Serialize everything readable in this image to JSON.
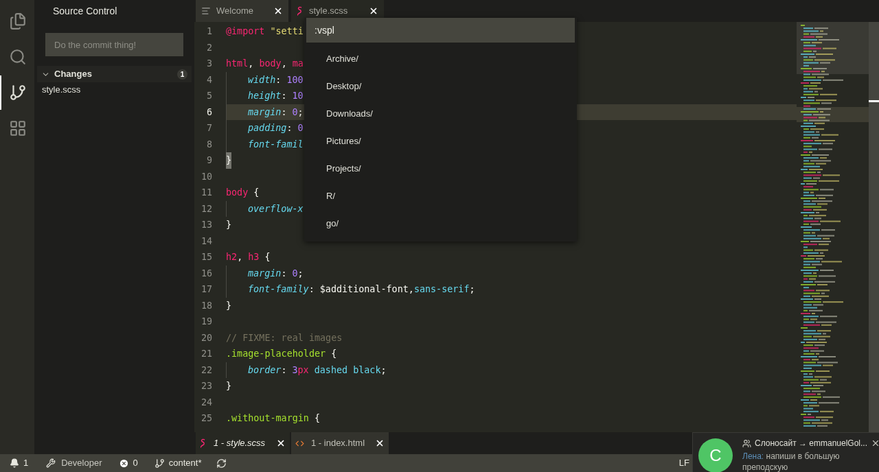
{
  "activity_bar": [
    {
      "kind": "files",
      "selected": false
    },
    {
      "kind": "search",
      "selected": false
    },
    {
      "kind": "source-control",
      "selected": true
    },
    {
      "kind": "extensions",
      "selected": false
    }
  ],
  "sidebar": {
    "title": "Source Control",
    "commit_field": {
      "placeholder": "Do the commit thing!"
    },
    "section": {
      "title": "Changes",
      "count": "1",
      "expanded": true,
      "files": [
        "style.scss"
      ]
    }
  },
  "editor_tabs": [
    {
      "label": "Welcome",
      "kind": "welcome",
      "selected": false
    },
    {
      "label": "style.scss",
      "kind": "scss",
      "selected": true
    }
  ],
  "code_lines": [
    {
      "number": "1",
      "indented": false,
      "current": false,
      "tokens": [
        {
          "kind": "keyword",
          "text": "@import"
        },
        {
          "kind": "string",
          "text": " \"setti"
        }
      ]
    },
    {
      "number": "2",
      "current": false
    },
    {
      "number": "3",
      "indented": false,
      "current": false,
      "tokens": [
        {
          "kind": "keyword",
          "text": "html"
        },
        {
          "kind": "plain",
          "text": ", "
        },
        {
          "kind": "keyword",
          "text": "body"
        },
        {
          "kind": "plain",
          "text": ", "
        },
        {
          "kind": "keyword",
          "text": "ma"
        }
      ]
    },
    {
      "number": "4",
      "indented": true,
      "current": false,
      "tokens": [
        {
          "kind": "property",
          "text": "width"
        },
        {
          "kind": "plain",
          "text": ": "
        },
        {
          "kind": "number",
          "text": "100"
        }
      ]
    },
    {
      "number": "5",
      "indented": true,
      "current": false,
      "tokens": [
        {
          "kind": "property",
          "text": "height"
        },
        {
          "kind": "plain",
          "text": ": "
        },
        {
          "kind": "number",
          "text": "10"
        }
      ]
    },
    {
      "number": "6",
      "indented": true,
      "current": true,
      "tokens": [
        {
          "kind": "property",
          "text": "margin"
        },
        {
          "kind": "plain",
          "text": ": "
        },
        {
          "kind": "number",
          "text": "0"
        },
        {
          "kind": "plain",
          "text": ";"
        }
      ]
    },
    {
      "number": "7",
      "indented": true,
      "current": false,
      "tokens": [
        {
          "kind": "property",
          "text": "padding"
        },
        {
          "kind": "plain",
          "text": ": "
        },
        {
          "kind": "number",
          "text": "0"
        }
      ]
    },
    {
      "number": "8",
      "indented": true,
      "current": false,
      "tokens": [
        {
          "kind": "property",
          "text": "font-famil"
        }
      ]
    },
    {
      "number": "9",
      "indented": false,
      "current": false,
      "tokens": [
        {
          "kind": "matched-bracket",
          "text": "}"
        }
      ]
    },
    {
      "number": "10",
      "current": false
    },
    {
      "number": "11",
      "indented": false,
      "current": false,
      "tokens": [
        {
          "kind": "keyword",
          "text": "body"
        },
        {
          "kind": "plain",
          "text": " {"
        }
      ]
    },
    {
      "number": "12",
      "indented": true,
      "current": false,
      "tokens": [
        {
          "kind": "property",
          "text": "overflow-x"
        }
      ]
    },
    {
      "number": "13",
      "indented": false,
      "current": false,
      "tokens": [
        {
          "kind": "plain",
          "text": "}"
        }
      ]
    },
    {
      "number": "14",
      "current": false
    },
    {
      "number": "15",
      "indented": false,
      "current": false,
      "tokens": [
        {
          "kind": "keyword",
          "text": "h2"
        },
        {
          "kind": "plain",
          "text": ", "
        },
        {
          "kind": "keyword",
          "text": "h3"
        },
        {
          "kind": "plain",
          "text": " {"
        }
      ]
    },
    {
      "number": "16",
      "indented": true,
      "current": false,
      "tokens": [
        {
          "kind": "property",
          "text": "margin"
        },
        {
          "kind": "plain",
          "text": ": "
        },
        {
          "kind": "number",
          "text": "0"
        },
        {
          "kind": "plain",
          "text": ";"
        }
      ]
    },
    {
      "number": "17",
      "indented": true,
      "current": false,
      "tokens": [
        {
          "kind": "property",
          "text": "font-family"
        },
        {
          "kind": "plain",
          "text": ": $additional-font,"
        },
        {
          "kind": "value",
          "text": "sans-serif"
        },
        {
          "kind": "plain",
          "text": ";"
        }
      ]
    },
    {
      "number": "18",
      "indented": false,
      "current": false,
      "tokens": [
        {
          "kind": "plain",
          "text": "}"
        }
      ]
    },
    {
      "number": "19",
      "current": false
    },
    {
      "number": "20",
      "indented": false,
      "current": false,
      "tokens": [
        {
          "kind": "comment",
          "text": "// FIXME: real images"
        }
      ]
    },
    {
      "number": "21",
      "indented": false,
      "current": false,
      "tokens": [
        {
          "kind": "selector",
          "text": ".image-placeholder"
        },
        {
          "kind": "plain",
          "text": " {"
        }
      ]
    },
    {
      "number": "22",
      "indented": true,
      "current": false,
      "tokens": [
        {
          "kind": "property",
          "text": "border"
        },
        {
          "kind": "plain",
          "text": ": "
        },
        {
          "kind": "number",
          "text": "3"
        },
        {
          "kind": "unit",
          "text": "px"
        },
        {
          "kind": "value",
          "text": " dashed"
        },
        {
          "kind": "value",
          "text": " black"
        },
        {
          "kind": "plain",
          "text": ";"
        }
      ]
    },
    {
      "number": "23",
      "indented": false,
      "current": false,
      "tokens": [
        {
          "kind": "plain",
          "text": "}"
        }
      ]
    },
    {
      "number": "24",
      "current": false
    },
    {
      "number": "25",
      "indented": false,
      "current": false,
      "tokens": [
        {
          "kind": "selector",
          "text": ".without-margin"
        },
        {
          "kind": "plain",
          "text": " {"
        }
      ]
    }
  ],
  "command_palette": {
    "value": ":vspl",
    "items": [
      "Archive/",
      "Desktop/",
      "Downloads/",
      "Pictures/",
      "Projects/",
      "R/",
      "go/"
    ]
  },
  "panel_tabs": [
    {
      "label": "1 - style.scss",
      "kind": "scss",
      "selected": true
    },
    {
      "label": "1 - index.html",
      "kind": "html",
      "selected": false
    }
  ],
  "status_bar": {
    "notifications": "1",
    "profile": "Developer",
    "errors": "0",
    "branch": "content*",
    "line_ending": "LF"
  },
  "notification": {
    "avatar": "С",
    "title": "Слоносайт → emmanuelGol...",
    "author": "Лена:",
    "message": "напиши в большую преподскую"
  }
}
